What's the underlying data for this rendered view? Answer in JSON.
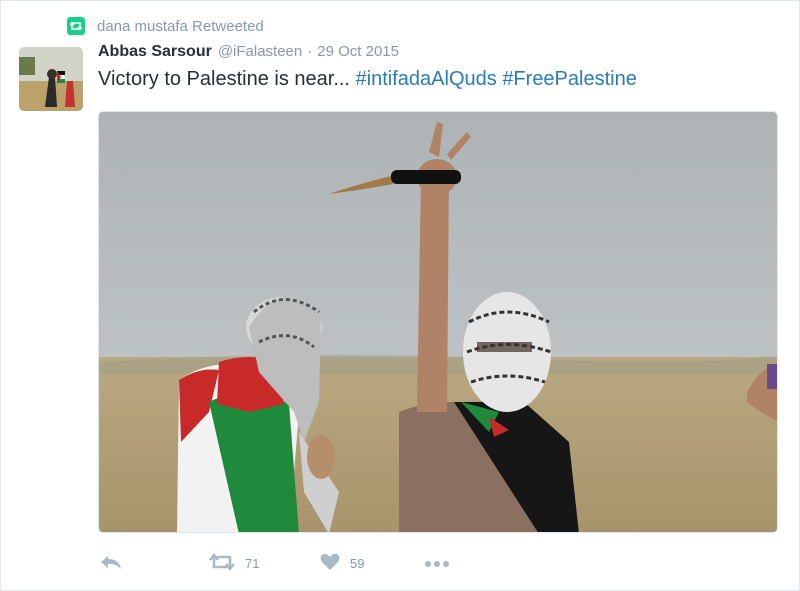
{
  "retweet": {
    "text": "dana mustafa Retweeted"
  },
  "tweet": {
    "author_name": "Abbas Sarsour",
    "author_handle": "@iFalasteen",
    "separator": "·",
    "date": "29 Oct 2015",
    "text": "Victory to Palestine is near...",
    "hashtags": [
      "#intifadaAlQuds",
      "#FreePalestine"
    ]
  },
  "actions": {
    "retweet_count": "71",
    "like_count": "59"
  },
  "colors": {
    "retweet_green": "#19cf86",
    "hashtag_blue": "#2b7bb9",
    "muted_gray": "#8899a6",
    "icon_gray": "#aab8c2"
  },
  "icons": [
    "retweet-badge-icon",
    "reply-icon",
    "retweet-icon",
    "heart-icon",
    "more-icon"
  ]
}
